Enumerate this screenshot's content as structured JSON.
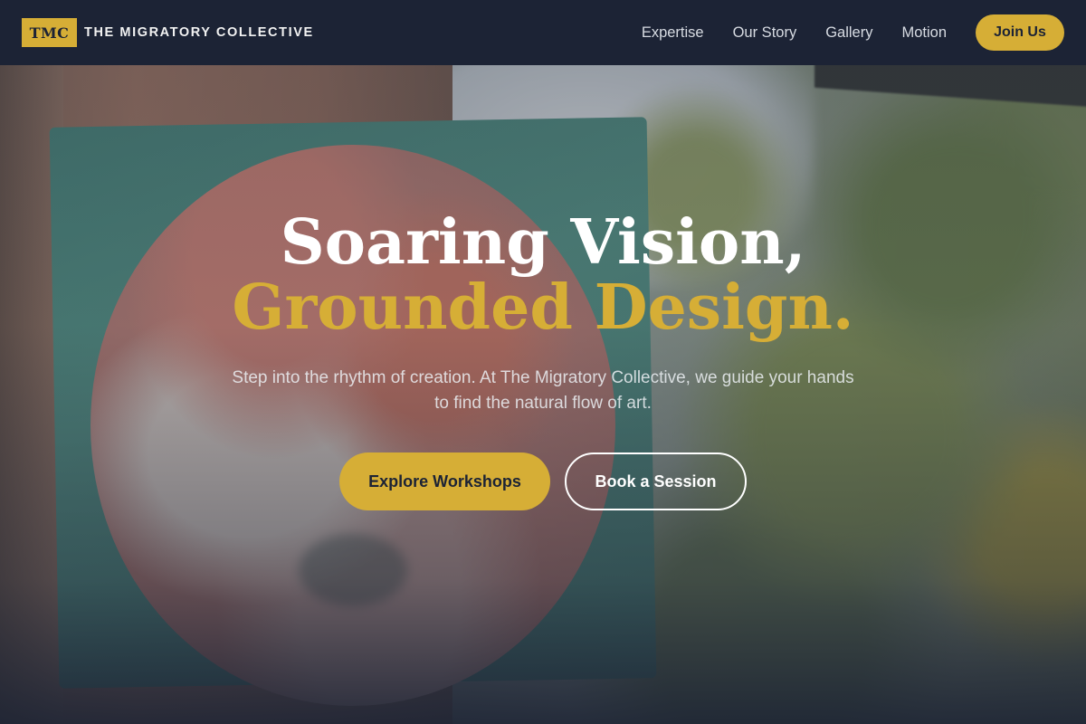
{
  "header": {
    "logo_text": "TMC",
    "brand_name": "THE MIGRATORY COLLECTIVE",
    "nav": [
      {
        "label": "Expertise"
      },
      {
        "label": "Our Story"
      },
      {
        "label": "Gallery"
      },
      {
        "label": "Motion"
      }
    ],
    "cta_label": "Join Us"
  },
  "hero": {
    "headline_line1": "Soaring Vision,",
    "headline_line2": "Grounded Design.",
    "subtitle": "Step into the rhythm of creation. At The Migratory Collective, we guide your hands to find the natural flow of art.",
    "primary_button": "Explore Workshops",
    "secondary_button": "Book a Session"
  },
  "colors": {
    "accent": "#d6ae36",
    "navy": "#1c2335",
    "white": "#ffffff"
  }
}
